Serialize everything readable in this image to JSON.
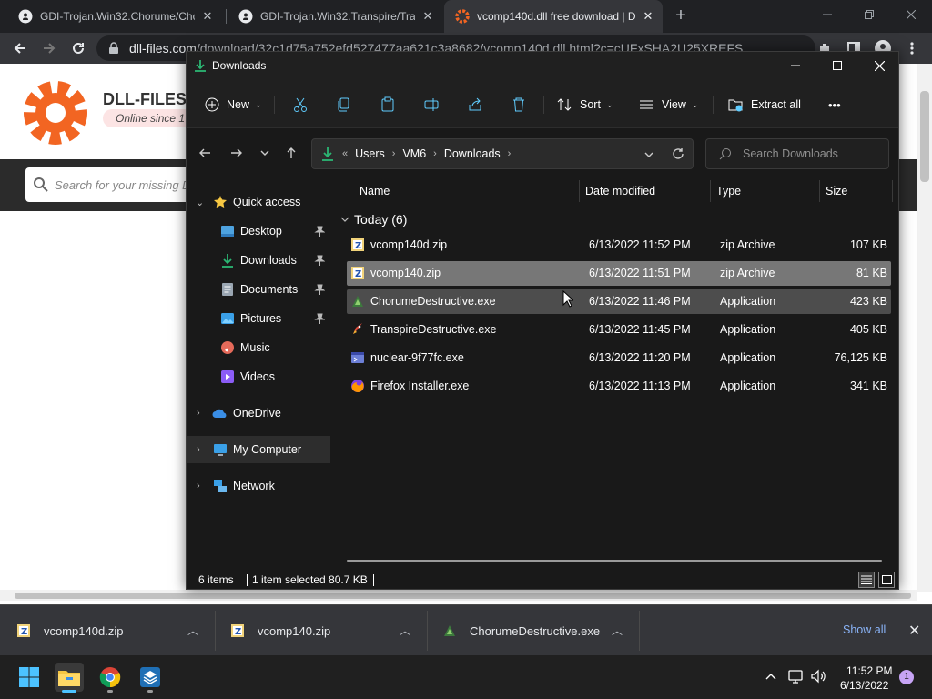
{
  "chrome": {
    "tabs": [
      {
        "title": "GDI-Trojan.Win32.Chorume/Chor",
        "icon": "github-icon"
      },
      {
        "title": "GDI-Trojan.Win32.Transpire/Trans",
        "icon": "github-icon"
      },
      {
        "title": "vcomp140d.dll free download | D",
        "icon": "dll-files-icon",
        "active": true
      }
    ],
    "new_tab": "+",
    "url_domain": "dll-files.com",
    "url_path": "/download/32c1d75a752efd527477aa621c3a8682/vcomp140d.dll.html?c=cUFxSHA2U25XREFS..."
  },
  "webpage": {
    "logo_text": "DLL-FILES.C",
    "since_text": "Online since 1",
    "search_placeholder": "Search for your missing D"
  },
  "explorer": {
    "title": "Downloads",
    "commands": {
      "new": "New",
      "sort": "Sort",
      "view": "View",
      "extract_all": "Extract all",
      "more": "•••"
    },
    "breadcrumb": [
      "Users",
      "VM6",
      "Downloads"
    ],
    "breadcrumb_prefix": "«",
    "search_placeholder": "Search Downloads",
    "nav": {
      "quick_access": "Quick access",
      "desktop": "Desktop",
      "downloads": "Downloads",
      "documents": "Documents",
      "pictures": "Pictures",
      "music": "Music",
      "videos": "Videos",
      "onedrive": "OneDrive",
      "my_computer": "My Computer",
      "network": "Network"
    },
    "columns": {
      "name": "Name",
      "date": "Date modified",
      "type": "Type",
      "size": "Size"
    },
    "group": "Today (6)",
    "files": [
      {
        "name": "vcomp140d.zip",
        "date": "6/13/2022 11:52 PM",
        "type": "zip Archive",
        "size": "107 KB",
        "icon": "zip-icon"
      },
      {
        "name": "vcomp140.zip",
        "date": "6/13/2022 11:51 PM",
        "type": "zip Archive",
        "size": "81 KB",
        "icon": "zip-icon",
        "selected": true
      },
      {
        "name": "ChorumeDestructive.exe",
        "date": "6/13/2022 11:46 PM",
        "type": "Application",
        "size": "423 KB",
        "icon": "exe-icon",
        "hovered": true
      },
      {
        "name": "TranspireDestructive.exe",
        "date": "6/13/2022 11:45 PM",
        "type": "Application",
        "size": "405 KB",
        "icon": "rocket-icon"
      },
      {
        "name": "nuclear-9f77fc.exe",
        "date": "6/13/2022 11:20 PM",
        "type": "Application",
        "size": "76,125 KB",
        "icon": "app-icon"
      },
      {
        "name": "Firefox Installer.exe",
        "date": "6/13/2022 11:13 PM",
        "type": "Application",
        "size": "341 KB",
        "icon": "firefox-icon"
      }
    ],
    "status": {
      "count": "6 items",
      "selection": "1 item selected  80.7 KB"
    }
  },
  "downloads_shelf": {
    "items": [
      "vcomp140d.zip",
      "vcomp140.zip",
      "ChorumeDestructive.exe"
    ],
    "show_all": "Show all"
  },
  "taskbar": {
    "time": "11:52 PM",
    "date": "6/13/2022",
    "notifications": "1"
  },
  "colors": {
    "explorer_bg": "#191919",
    "selection": "#777777",
    "chrome_dark": "#202124",
    "accent_link": "#8ab4f8",
    "dll_orange": "#f26522"
  }
}
